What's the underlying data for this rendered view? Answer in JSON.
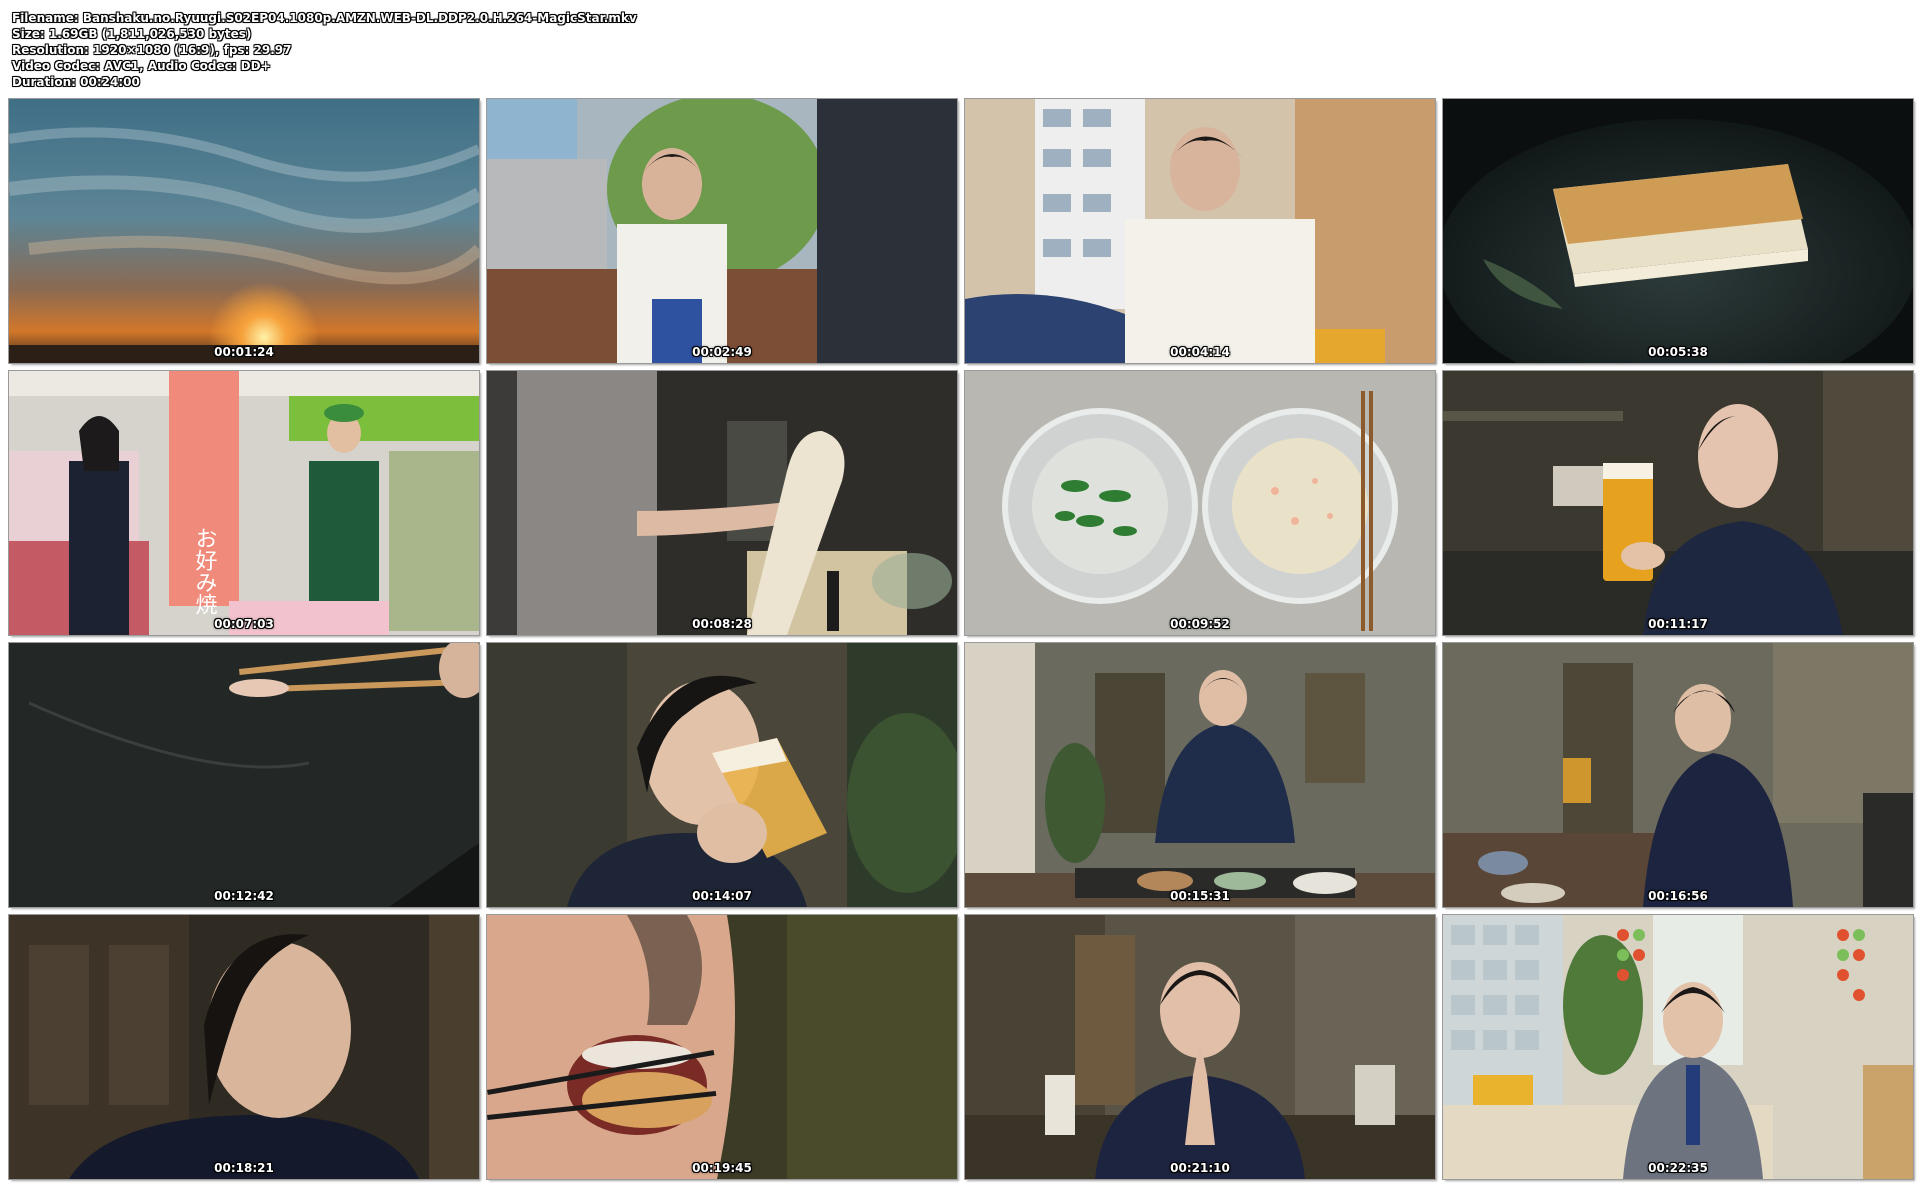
{
  "file_info": {
    "filename": "Filename: Banshaku.no.Ryuugi.S02EP04.1080p.AMZN.WEB-DL.DDP2.0.H.264-MagicStar.mkv",
    "size": "Size: 1.69GB (1,811,026,530 bytes)",
    "resolution": "Resolution: 1920×1080 (16:9), fps: 29.97",
    "codec": "Video Codec: AVC1, Audio Codec: DD+",
    "duration": "Duration: 00:24:00"
  },
  "thumbnails": [
    {
      "timestamp": "00:01:24"
    },
    {
      "timestamp": "00:02:49"
    },
    {
      "timestamp": "00:04:14"
    },
    {
      "timestamp": "00:05:38"
    },
    {
      "timestamp": "00:07:03",
      "sign_text": "お好み焼"
    },
    {
      "timestamp": "00:08:28"
    },
    {
      "timestamp": "00:09:52"
    },
    {
      "timestamp": "00:11:17"
    },
    {
      "timestamp": "00:12:42"
    },
    {
      "timestamp": "00:14:07"
    },
    {
      "timestamp": "00:15:31"
    },
    {
      "timestamp": "00:16:56"
    },
    {
      "timestamp": "00:18:21"
    },
    {
      "timestamp": "00:19:45"
    },
    {
      "timestamp": "00:21:10"
    },
    {
      "timestamp": "00:22:35"
    }
  ]
}
